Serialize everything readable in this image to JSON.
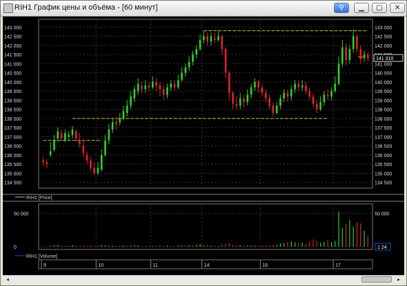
{
  "window": {
    "title": "RIH1 График цены и объёма - [60 минут]"
  },
  "titlebar_buttons": {
    "link_glyph": "⚲",
    "minimize_glyph": "▁",
    "maximize_glyph": "▢",
    "close_glyph": "✕"
  },
  "colors": {
    "background": "#000000",
    "up": "#2fd12f",
    "down": "#e0242a",
    "volume_line": "#1e4fd8",
    "level_line": "#c9c93a",
    "grid": "#3a3a3a"
  },
  "price_panel": {
    "legend_label": "RIH1 [Price]",
    "y_ticks": [
      "143 000",
      "142 500",
      "142 000",
      "141 500",
      "141 000",
      "140 500",
      "140 000",
      "139 500",
      "139 000",
      "138 500",
      "138 000",
      "137 500",
      "137 000",
      "136 500",
      "136 000",
      "135 500",
      "135 000",
      "134 500"
    ],
    "current_price": "141 310",
    "levels": [
      {
        "value": 142800
      },
      {
        "value": 138000
      },
      {
        "value": 136800
      }
    ]
  },
  "volume_panel": {
    "legend_label": "RIH1 [Volume]",
    "y_ticks": [
      "50 000",
      "0"
    ],
    "current_label": "1 24"
  },
  "x_axis": {
    "day_labels": [
      "9",
      "10",
      "11",
      "14",
      "16",
      "17"
    ]
  },
  "scrollbar": {
    "left_arrow": "◂",
    "right_arrow": "▸"
  },
  "chart_data": {
    "type": "candlestick",
    "interval": "60 минут",
    "instrument": "RIH1",
    "ylim": [
      134300,
      143200
    ],
    "day_labels": [
      "9",
      "10",
      "11",
      "14",
      "16",
      "17"
    ],
    "candles": [
      [
        135700,
        135600,
        135900,
        135400
      ],
      [
        135600,
        135500,
        135800,
        135300
      ],
      [
        136000,
        136200,
        136700,
        135900
      ],
      [
        136300,
        136800,
        137100,
        136200
      ],
      [
        136900,
        137300,
        137500,
        136700
      ],
      [
        137200,
        136900,
        137400,
        136800
      ],
      [
        136800,
        137200,
        137400,
        136700
      ],
      [
        137000,
        137100,
        137300,
        136800
      ],
      [
        137100,
        137400,
        137600,
        136900
      ],
      [
        137300,
        136900,
        137400,
        136700
      ],
      [
        136800,
        136600,
        137200,
        136400
      ],
      [
        136500,
        136100,
        136800,
        135900
      ],
      [
        136000,
        135700,
        136200,
        135500
      ],
      [
        135700,
        135300,
        135900,
        135100
      ],
      [
        135300,
        135000,
        135600,
        134900
      ],
      [
        135000,
        135300,
        135600,
        134900
      ],
      [
        135200,
        136000,
        136300,
        135100
      ],
      [
        136000,
        136800,
        137100,
        135900
      ],
      [
        136800,
        137400,
        137700,
        136600
      ],
      [
        137400,
        137800,
        138000,
        137200
      ],
      [
        137800,
        137700,
        138100,
        137400
      ],
      [
        137800,
        138000,
        138300,
        137600
      ],
      [
        138000,
        138400,
        138700,
        137900
      ],
      [
        138300,
        138700,
        139000,
        138100
      ],
      [
        138700,
        139200,
        139500,
        138500
      ],
      [
        139100,
        139600,
        139800,
        138900
      ],
      [
        139500,
        139900,
        140200,
        139300
      ],
      [
        139800,
        139600,
        140000,
        139400
      ],
      [
        139600,
        139800,
        140100,
        139400
      ],
      [
        139800,
        139700,
        140000,
        139500
      ],
      [
        139700,
        140000,
        140300,
        139600
      ],
      [
        140000,
        139800,
        140200,
        139500
      ],
      [
        139800,
        139600,
        140000,
        139200
      ],
      [
        139600,
        139300,
        139800,
        139000
      ],
      [
        139300,
        139700,
        139900,
        139100
      ],
      [
        139700,
        139900,
        140100,
        139500
      ],
      [
        139900,
        139700,
        140100,
        139500
      ],
      [
        139700,
        140100,
        140400,
        139600
      ],
      [
        140100,
        140500,
        140800,
        140000
      ],
      [
        140500,
        140800,
        141000,
        140300
      ],
      [
        140800,
        141100,
        141400,
        140600
      ],
      [
        141100,
        141500,
        141700,
        140900
      ],
      [
        141500,
        141800,
        142000,
        141300
      ],
      [
        141800,
        142300,
        142600,
        141700
      ],
      [
        142300,
        142500,
        142800,
        142100
      ],
      [
        142500,
        142200,
        142700,
        142000
      ],
      [
        142200,
        142500,
        142700,
        142000
      ],
      [
        142400,
        142300,
        142700,
        142100
      ],
      [
        142300,
        142500,
        142800,
        142200
      ],
      [
        142500,
        141800,
        142600,
        141500
      ],
      [
        141800,
        140500,
        141900,
        140200
      ],
      [
        140500,
        139400,
        140600,
        139000
      ],
      [
        139400,
        138800,
        139500,
        138500
      ],
      [
        138800,
        138700,
        139200,
        138500
      ],
      [
        138700,
        139100,
        139400,
        138500
      ],
      [
        139100,
        138900,
        139300,
        138600
      ],
      [
        138900,
        139300,
        139600,
        138700
      ],
      [
        139300,
        139700,
        139900,
        139100
      ],
      [
        139700,
        140000,
        140200,
        139500
      ],
      [
        140000,
        139700,
        140100,
        139400
      ],
      [
        139700,
        139400,
        139900,
        139200
      ],
      [
        139400,
        139100,
        139600,
        138900
      ],
      [
        139100,
        138700,
        139300,
        138500
      ],
      [
        138700,
        138300,
        138900,
        138100
      ],
      [
        138300,
        138700,
        138900,
        138200
      ],
      [
        138700,
        139100,
        139300,
        138500
      ],
      [
        139100,
        139400,
        139600,
        138900
      ],
      [
        139400,
        139200,
        139600,
        138900
      ],
      [
        139200,
        139600,
        139800,
        139000
      ],
      [
        139600,
        139900,
        140100,
        139400
      ],
      [
        139900,
        139700,
        140100,
        139500
      ],
      [
        139700,
        139800,
        140100,
        139500
      ],
      [
        139800,
        139500,
        140000,
        139300
      ],
      [
        139500,
        139200,
        139700,
        139000
      ],
      [
        139200,
        138800,
        139400,
        138600
      ],
      [
        138800,
        138500,
        139000,
        138300
      ],
      [
        138500,
        138900,
        139200,
        138400
      ],
      [
        138900,
        139300,
        139500,
        138700
      ],
      [
        139300,
        139200,
        139600,
        139000
      ],
      [
        139200,
        139500,
        139700,
        139000
      ],
      [
        139500,
        139900,
        140300,
        139400
      ],
      [
        139900,
        141000,
        141400,
        139800
      ],
      [
        141000,
        141900,
        142300,
        140800
      ],
      [
        141900,
        141200,
        142100,
        140900
      ],
      [
        141200,
        141800,
        142000,
        141000
      ],
      [
        141800,
        142500,
        142900,
        141600
      ],
      [
        142500,
        141800,
        142600,
        141600
      ],
      [
        141800,
        141300,
        142000,
        141000
      ],
      [
        141300,
        141500,
        141700,
        141100
      ],
      [
        141500,
        141300,
        141600,
        141100
      ]
    ],
    "volumes": [
      800,
      600,
      1200,
      2500,
      3000,
      1500,
      1200,
      900,
      2500,
      1600,
      1000,
      1200,
      1400,
      1800,
      1100,
      1500,
      2600,
      2000,
      1200,
      1800,
      1500,
      1100,
      2200,
      1200,
      1500,
      2400,
      2100,
      1300,
      900,
      1300,
      1200,
      1500,
      2800,
      1100,
      1500,
      900,
      800,
      2100,
      1700,
      1300,
      2500,
      1600,
      3100,
      4200,
      1800,
      2500,
      1600,
      1200,
      1100,
      3800,
      4500,
      5200,
      3000,
      2200,
      2500,
      1800,
      2100,
      1600,
      1900,
      1300,
      2200,
      1900,
      2600,
      3000,
      2700,
      5200,
      6000,
      7100,
      8300,
      6800,
      5400,
      6200,
      4000,
      7700,
      11000,
      9000,
      6000,
      7600,
      9800,
      6800,
      9000,
      53000,
      28000,
      34000,
      40000,
      30000,
      37000,
      35000,
      24000,
      16000
    ]
  }
}
